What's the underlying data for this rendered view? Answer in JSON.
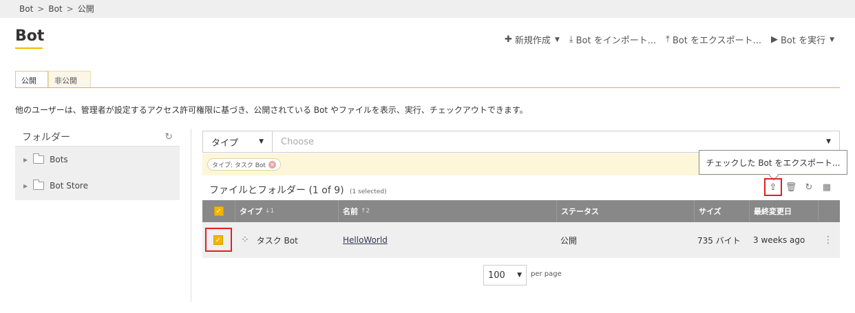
{
  "breadcrumb": {
    "items": [
      "Bot",
      "Bot",
      "公開"
    ],
    "sep": ">"
  },
  "page": {
    "title": "Bot",
    "description": "他のユーザーは、管理者が設定するアクセス許可権限に基づき、公開されている Bot やファイルを表示、実行、チェックアウトできます。"
  },
  "actions": {
    "new": "新規作成",
    "import": "Bot をインポート...",
    "export": "Bot をエクスポート...",
    "run": "Bot を実行"
  },
  "tabs": {
    "public": "公開",
    "private": "非公開"
  },
  "folders": {
    "title": "フォルダー",
    "items": [
      "Bots",
      "Bot Store"
    ]
  },
  "filter": {
    "type_label": "タイプ",
    "placeholder": "Choose",
    "chip": "タイプ: タスク Bot"
  },
  "tooltip": "チェックした Bot をエクスポート...",
  "list": {
    "title": "ファイルとフォルダー",
    "count": "(1 of 9)",
    "selected": "(1 selected)"
  },
  "table": {
    "headers": {
      "type": "タイプ",
      "type_sort": "↓1",
      "name": "名前",
      "name_sort": "↑2",
      "status": "ステータス",
      "size": "サイズ",
      "modified": "最終変更日"
    },
    "rows": [
      {
        "type": "タスク Bot",
        "name": "HelloWorld",
        "status": "公開",
        "size": "735 バイト",
        "modified": "3 weeks ago"
      }
    ]
  },
  "pager": {
    "per_page_value": "100",
    "per_page_label": "per page"
  },
  "colors": {
    "accent": "#f2b600",
    "highlight": "#e02020",
    "header": "#888888"
  }
}
